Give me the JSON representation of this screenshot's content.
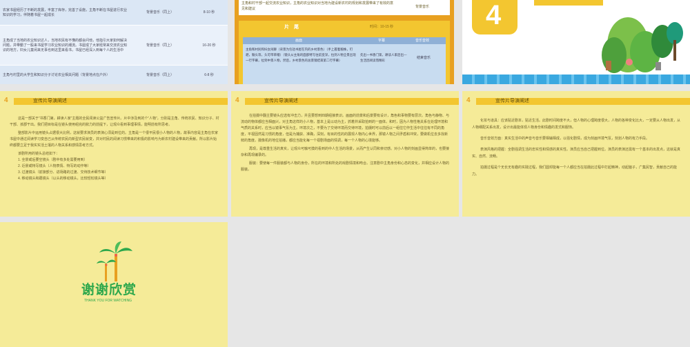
{
  "slide1": {
    "rows": [
      {
        "desc": "农家书屋经历了不断的发展，丰富了库存，完善了设施，主角不断在书屋进行农业知识的学习，伴随着书屋一起成长",
        "music": "背景音乐（同上）",
        "time": "8-10 秒"
      },
      {
        "desc": "主角成了当地的农业知识达人，当地农民有不懂的都会问他，他指引大家如何解决问题，并带動了一股来书屋学习农业知识的潮流。书屋成了大家经常来交流农业知识的地方，妇女儿童闲来无事也到这里来看书，书屋已经深入到每个人的生活中",
        "music": "背景音乐（同上）",
        "time": "16-20 秒"
      },
      {
        "desc": "主角与村里的大学生和知识分子讨论农业相关问题（背景地点在户外）",
        "music": "背景音乐（同上）",
        "time": "6-8 秒"
      }
    ]
  },
  "slide2": {
    "top_text": "主角和村干部一起交流农业知识，主角的农业知识对当地为建设新农村的规划和发展带来了有效的意见和建议",
    "top_music": "背景音乐",
    "section_title": "片　尾",
    "section_time": "时间：10-15 秒",
    "col_headers": [
      "画面",
      "字幕",
      "音乐音效"
    ],
    "row_desc": "主角和村民和妇女闲聊（背景为包括书屋在内的乡村景色）（手上握着粮株，钉耙，锄头等，头可带草帽）（镜头从主角的面部特写往前变深，拉到人物全景出现一行字幕，拉到中景人物，然后，乡村景色的总景镜结束第二行字幕）",
    "row_sub": "先出一书香门第，耕读人家后出—生活因阅读而精彩",
    "row_music": "结束音乐"
  },
  "slide3": {
    "number": "4"
  },
  "slide4": {
    "num": "4",
    "title": "宣传片导演阐述",
    "paras": [
      "这是一部关于“书香门第，耕读人家”主题的全民阅读公益广告宣传片。片中涉及到的个“人物”，分别是主角、传统农民、知识分子、村干部、孩郡干出。我们把目标是在镜头使用组完的掀力的前提下，让观众看到事理事情，能明前有所思考。",
      "整部影片中运用镜头占据很大比例，这就要求演员的表演心须是到位的。主角是一个很平民很小人物的人物，故事内容是主角在农家书屋中通过阅读学习变自己从传统农民向新型农民就变，并对村民的阅读习惯带来的积极的影响与为新农村建设带来的贡献。所以影片始终都要立足于我实实活土壤的人物关系和感情思考方式。",
      "该剧所用的镜头总结如下：",
      "1. 全景或后要空镜头（剧中有多处需要用到）",
      "2. 近景或特写镜头（人物表情、特写的动作等）",
      "3. 过渡镜头（前接部分、进场路的过渡、交待技术细节等）",
      "4. 移动镜头和跟镜头（以头的移动镜头，比较轻松镜头等）"
    ]
  },
  "slide5": {
    "num": "4",
    "title": "宣传片导演阐述",
    "paras": [
      "在拍摄中翻主要镜头应选有冲击力，并且要想到四期组接表识。画面的前景和后景要有设计，角色和事物要有层次。角色与静物、与流动的物体都应当相面兴，对主角这样的小人物，基本上是以动为主，抓着并采取拍到的一面体。和时，因为人物性格关系在处理环境和气质的关系时，应当以镜事气氛为主。环境次之，不要为了交待环境而交待环境，拍摄时可以前后以一组住它作生活中往往有不同的角度，平视固然是习惯的角度，但是为捕获、准确，深刻，有目的性的的展现人物内心世界，那镜人物之间矛盾和冲突，要做机位去多找新鲜的角度。摄像机的地位拍播，都应当能化每一个视剧场面的情调，每一个人物的心境能够。",
      "再现，是尊重生活的真实，让观众可触可摸的看到的中人生活的场景，从而产生认同和亲切感。对小人物的刻画显得简单的，也要接杂和再现编录的。",
      "服装：要使每一件服装都与人物的身份，所在的环境和所处的戏剧情境和吻合。注意剧中主角身份和心态的变化，并相应设计人物的服装。"
    ]
  },
  "slide6": {
    "num": "4",
    "title": "宣传片导演阐述",
    "paras": [
      "化妆与道具：应该贴近剧本，贴近生活。此剧时间跨度不大，但人物的心理跨度很大，人物的各种变化比大，一定要从人物出发，从人物细配关系出发，设计出最能体现人物身份和情趣的发式和服饰。",
      "音乐音效方面：真实生活中的声音与音乐要相辅相成，以强化剧情，成为刻画环境气氛，刻划人物的有力手段。",
      "表演风格的把握：全剧强调生活的忠实性和情感的真实性。演员应当自己把握到位。演员的表演还需有一个基本的出发点，这就是真实、自然、流畅。",
      "拍摄过程是个无长无有趣的实践过程，我们圆却能每一个人都应当在拍摄此过程中打起精神，动起脑子，广集民智，贡献自己的能力。"
    ]
  },
  "slide7": {
    "thanks": "谢谢欣赏",
    "thanks_en": "THANK YOU FOR WATCHING"
  },
  "colors": {
    "slide_bg": "#f5eb98",
    "accent_yellow": "#f3c630",
    "accent_orange": "#e8a020",
    "green": "#2ea84c",
    "blue": "#3aa8e0"
  }
}
